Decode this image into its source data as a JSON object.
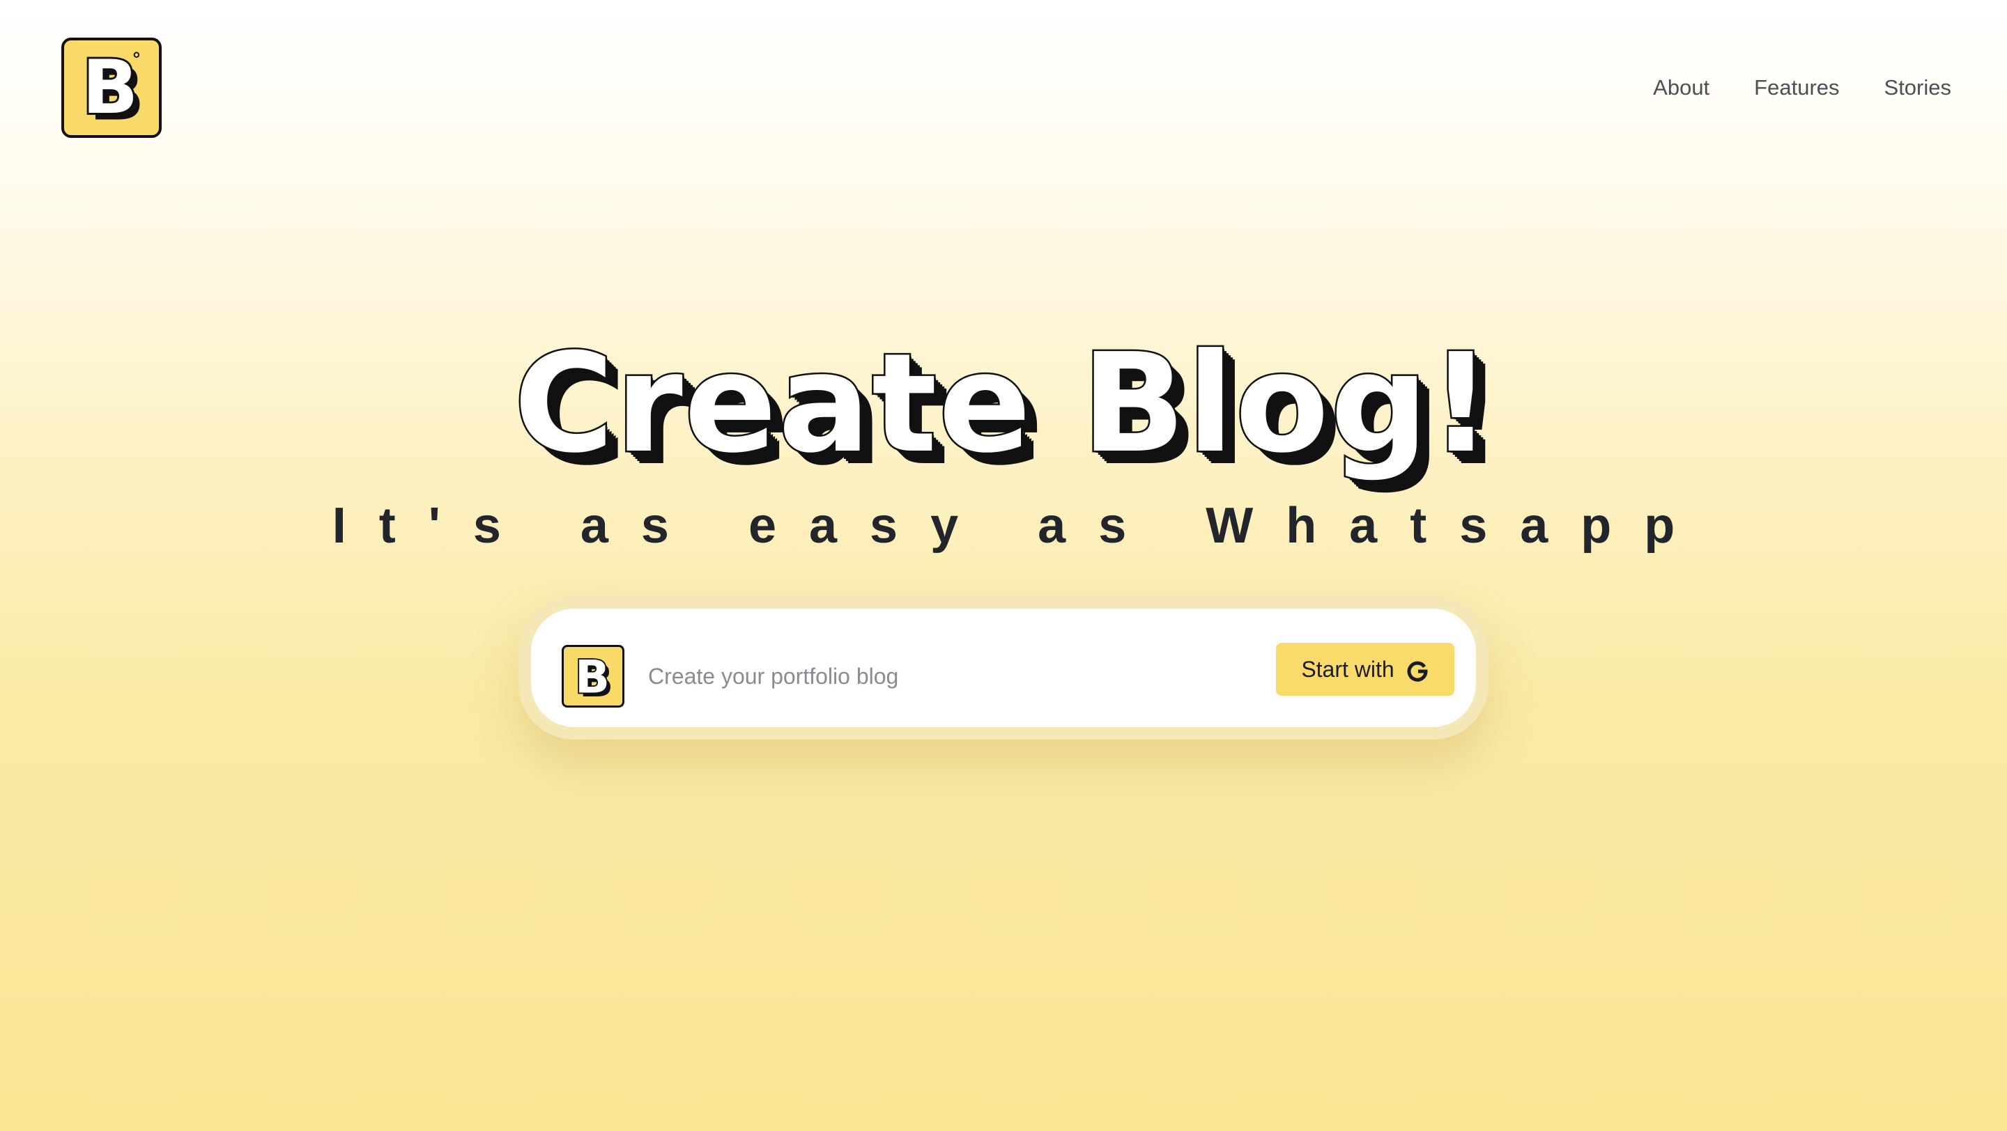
{
  "brand": {
    "logo_icon": "b-logo-icon",
    "logo_letter": "B",
    "accent_color": "#f9d968"
  },
  "nav": {
    "items": [
      {
        "label": "About"
      },
      {
        "label": "Features"
      },
      {
        "label": "Stories"
      }
    ]
  },
  "hero": {
    "title": "Create Blog!",
    "subtitle": "It's as easy as Whatsapp"
  },
  "cta": {
    "input_placeholder": "Create your portfolio blog",
    "input_value": "",
    "button_label": "Start with",
    "button_icon": "google-icon",
    "button_color": "#f9db6b"
  }
}
